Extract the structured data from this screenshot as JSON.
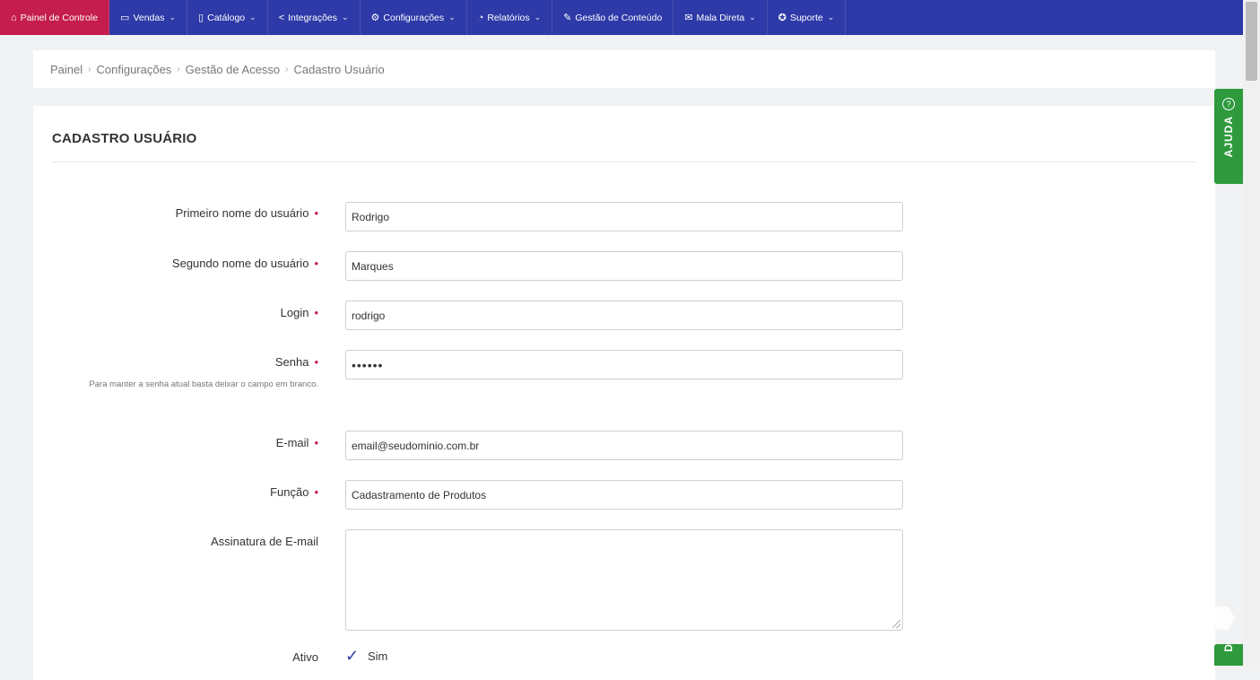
{
  "nav": {
    "items": [
      {
        "icon": "⌂",
        "label": "Painel de Controle",
        "caret": ""
      },
      {
        "icon": "▭",
        "label": "Vendas",
        "caret": "⌄"
      },
      {
        "icon": "▯",
        "label": "Catálogo",
        "caret": "⌄"
      },
      {
        "icon": "<",
        "label": "Integrações",
        "caret": "⌄"
      },
      {
        "icon": "⚙",
        "label": "Configurações",
        "caret": "⌄"
      },
      {
        "icon": "◔",
        "label": "Relatórios",
        "caret": "⌄"
      },
      {
        "icon": "✎",
        "label": "Gestão de Conteúdo",
        "caret": ""
      },
      {
        "icon": "✉",
        "label": "Mala Direta",
        "caret": "⌄"
      },
      {
        "icon": "✪",
        "label": "Suporte",
        "caret": "⌄"
      }
    ]
  },
  "breadcrumb": {
    "items": [
      "Painel",
      "Configurações",
      "Gestão de Acesso",
      "Cadastro Usuário"
    ],
    "separator": "›"
  },
  "form": {
    "title": "CADASTRO USUÁRIO",
    "required_mark": "•",
    "first_name": {
      "label": "Primeiro nome do usuário",
      "value": "Rodrigo"
    },
    "last_name": {
      "label": "Segundo nome do usuário",
      "value": "Marques"
    },
    "login": {
      "label": "Login",
      "value": "rodrigo"
    },
    "password": {
      "label": "Senha",
      "value": "••••••",
      "hint": "Para manter a senha atual basta deixar o campo em branco."
    },
    "email": {
      "label": "E-mail",
      "value": "email@seudominio.com.br"
    },
    "role": {
      "label": "Função",
      "value": "Cadastramento de Produtos"
    },
    "signature": {
      "label": "Assinatura de E-mail",
      "value": ""
    },
    "active": {
      "label": "Ativo",
      "check": "✓",
      "value": "Sim"
    }
  },
  "help": {
    "label": "AJUDA",
    "icon": "?",
    "bottom_label": "D"
  },
  "colors": {
    "nav_bg": "#2e3aa8",
    "nav_active": "#c51d4d",
    "help_green": "#2e9a3d",
    "required": "#c51d4d"
  }
}
